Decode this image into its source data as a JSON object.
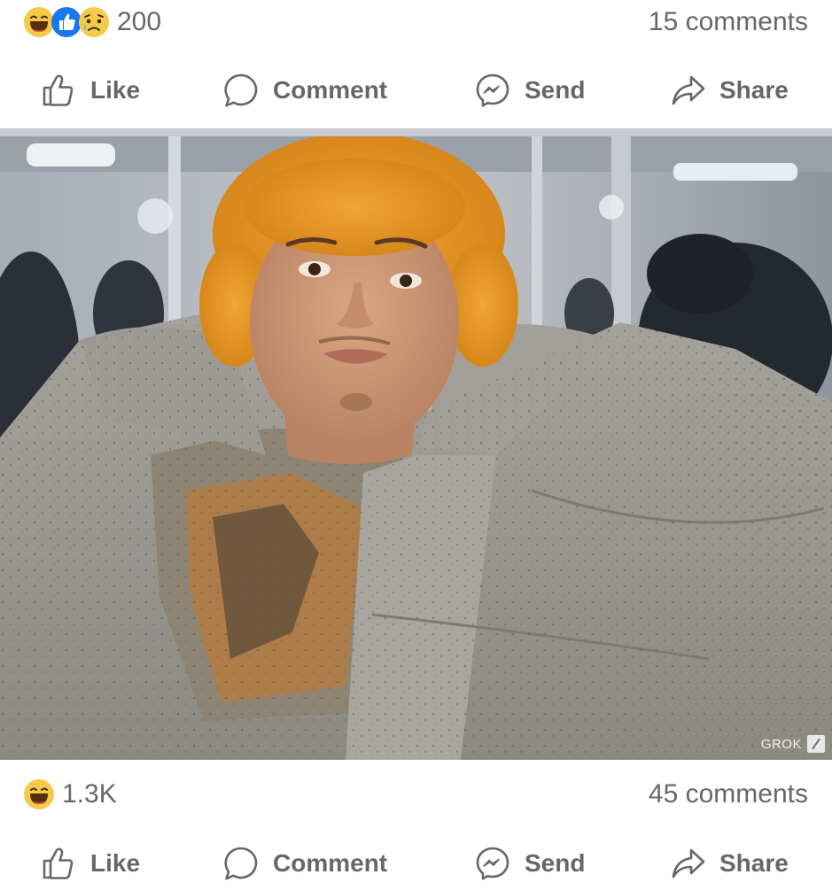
{
  "post1": {
    "reactions": [
      "haha",
      "like",
      "sad"
    ],
    "reaction_count": "200",
    "comments": "15 comments",
    "actions": {
      "like": "Like",
      "comment": "Comment",
      "send": "Send",
      "share": "Share"
    }
  },
  "image": {
    "watermark": "GROK"
  },
  "post2": {
    "reactions": [
      "haha"
    ],
    "reaction_count": "1.3K",
    "comments": "45 comments",
    "actions": {
      "like": "Like",
      "comment": "Comment",
      "send": "Send",
      "share": "Share"
    }
  },
  "colors": {
    "text_secondary": "#65676b",
    "like_blue": "#1877f2",
    "emoji_yellow": "#f7c948",
    "divider": "#c9ccd1"
  }
}
